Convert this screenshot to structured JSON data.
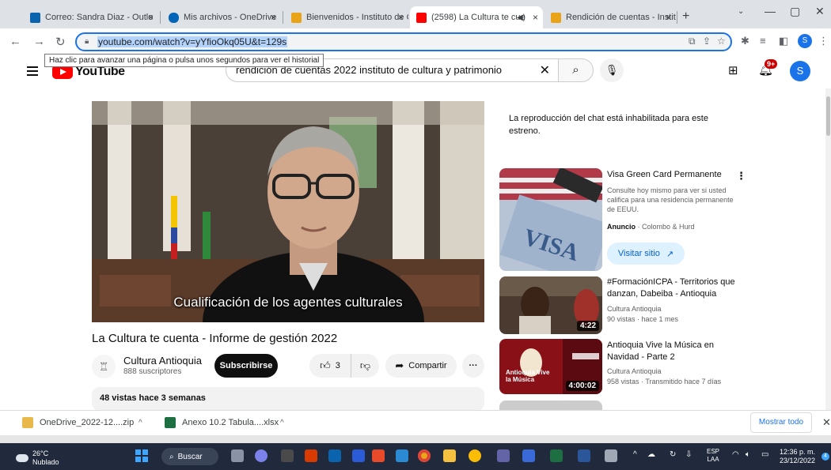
{
  "browser": {
    "tabs": [
      {
        "label": "Correo: Sandra Diaz - Outlo",
        "color": "#0a64ad"
      },
      {
        "label": "Mis archivos - OneDrive",
        "color": "#0364b8"
      },
      {
        "label": "Bienvenidos - Instituto de C",
        "color": "#e8a317"
      },
      {
        "label": "(2598) La Cultura te cue",
        "color": "#ff0000"
      },
      {
        "label": "Rendición de cuentas - Instit",
        "color": "#e8a317"
      }
    ],
    "close_glyph": "×",
    "new_tab_glyph": "+",
    "url": "youtube.com/watch?v=yYfioOkq05U&t=129s",
    "tooltip": "Haz clic para avanzar una página o pulsa unos segundos para ver el historial",
    "profile_initial": "S"
  },
  "youtube": {
    "logo_text": "YouTube",
    "search_query": "rendición de cuentas 2022 instituto de cultura y patrimonio",
    "notification_count": "9+",
    "avatar_initial": "S",
    "video": {
      "subtitle": "Cualificación de los agentes culturales",
      "title": "La Cultura te cuenta - Informe de gestión 2022",
      "channel": "Cultura Antioquia",
      "subscribers": "888 suscriptores",
      "subscribe_label": "Subscribirse",
      "likes": "3",
      "share_label": "Compartir",
      "more_glyph": "···",
      "stats": "48 vistas  hace 3 semanas"
    },
    "chat_message": "La reproducción del chat está inhabilitada para este estreno.",
    "ad": {
      "title": "Visa Green Card Permanente",
      "description": "Consulte hoy mismo para ver si usted califica para una residencia permanente de EEUU.",
      "label": "Anuncio",
      "advertiser": "· Colombo & Hurd",
      "visit_label": "Visitar sitio"
    },
    "recommendations": [
      {
        "title": "#FormaciónICPA - Territorios que danzan, Dabeiba - Antioquia",
        "channel": "Cultura Antioquia",
        "meta": "90 vistas  · hace 1 mes",
        "duration": "4:22"
      },
      {
        "title": "Antioquia Vive la Música en Navidad - Parte 2",
        "channel": "Cultura Antioquia",
        "meta": "958 vistas  · Transmitido hace 7 días",
        "duration": "4:00:02",
        "thumb_text": "Antioquia Vive la Música"
      }
    ]
  },
  "downloads": {
    "items": [
      {
        "label": "OneDrive_2022-12....zip"
      },
      {
        "label": "Anexo 10.2 Tabula....xlsx"
      }
    ],
    "caret_glyph": "^",
    "show_all_label": "Mostrar todo"
  },
  "taskbar": {
    "temperature": "26°C",
    "weather": "Nublado",
    "search_label": "Buscar",
    "language_1": "ESP",
    "language_2": "LAA",
    "time": "12:36 p. m.",
    "date": "23/12/2022",
    "notification_count": "4"
  }
}
